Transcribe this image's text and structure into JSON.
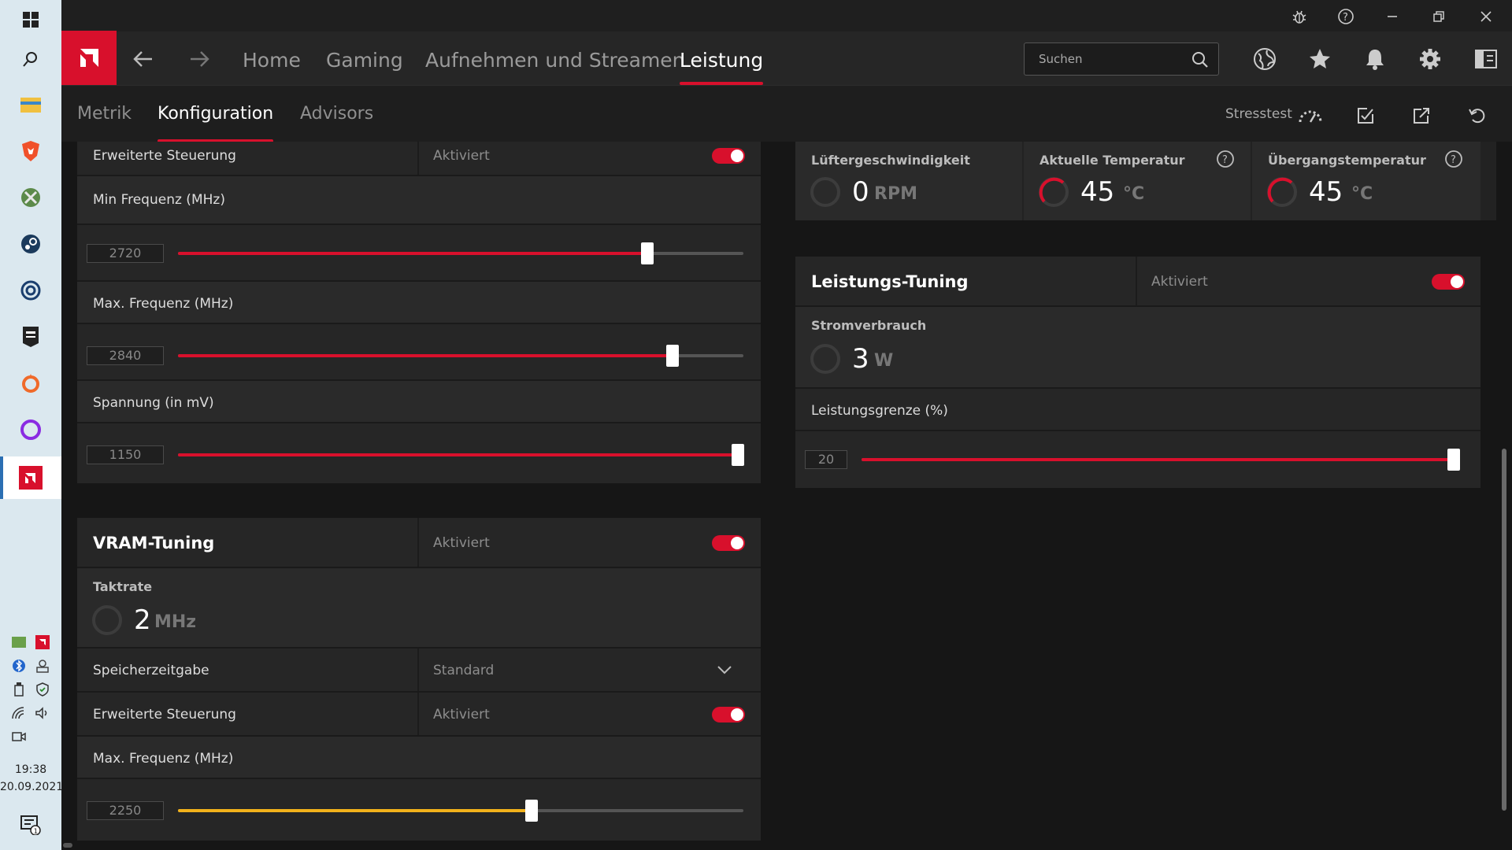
{
  "taskbar": {
    "clock_time": "19:38",
    "clock_date": "20.09.2021"
  },
  "nav": {
    "tabs": [
      "Home",
      "Gaming",
      "Aufnehmen und Streamen",
      "Leistung"
    ],
    "active_tab": "Leistung",
    "search_placeholder": "Suchen"
  },
  "subnav": {
    "tabs": [
      "Metrik",
      "Konfiguration",
      "Advisors"
    ],
    "active_tab": "Konfiguration",
    "stresstest_label": "Stresstest"
  },
  "gpu_tuning": {
    "erweiterte_label": "Erweiterte Steuerung",
    "erweiterte_value": "Aktiviert",
    "min_freq_label": "Min Frequenz (MHz)",
    "min_freq_value": "2720",
    "min_freq_fraction": 0.83,
    "max_freq_label": "Max. Frequenz (MHz)",
    "max_freq_value": "2840",
    "max_freq_fraction": 0.875,
    "voltage_label": "Spannung (in mV)",
    "voltage_value": "1150",
    "voltage_fraction": 0.99
  },
  "vram_tuning": {
    "title": "VRAM-Tuning",
    "status": "Aktiviert",
    "clock_label": "Taktrate",
    "clock_value": "2",
    "clock_unit": "MHz",
    "timing_label": "Speicherzeitgabe",
    "timing_value": "Standard",
    "erweiterte_label": "Erweiterte Steuerung",
    "erweiterte_value": "Aktiviert",
    "max_freq_label": "Max. Frequenz (MHz)",
    "max_freq_value": "2250",
    "max_freq_fraction": 0.625
  },
  "metrics": {
    "fan_label": "Lüftergeschwindigkeit",
    "fan_value": "0",
    "fan_unit": "RPM",
    "temp_label": "Aktuelle Temperatur",
    "temp_value": "45",
    "temp_unit": "°C",
    "junction_label": "Übergangstemperatur",
    "junction_value": "45",
    "junction_unit": "°C"
  },
  "power_tuning": {
    "title": "Leistungs-Tuning",
    "status": "Aktiviert",
    "power_label": "Stromverbrauch",
    "power_value": "3",
    "power_unit": "W",
    "limit_label": "Leistungsgrenze (%)",
    "limit_value": "20",
    "limit_fraction": 0.995
  },
  "colors": {
    "accent": "#d8102c",
    "vram_slider": "#f2b21b"
  }
}
